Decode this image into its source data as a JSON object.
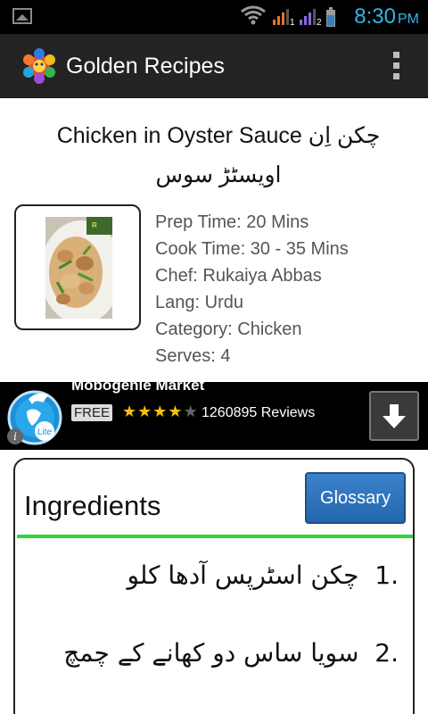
{
  "status_bar": {
    "time": "8:30",
    "ampm": "PM",
    "sim1": "1",
    "sim2": "2"
  },
  "action_bar": {
    "title": "Golden Recipes",
    "logo_icon": "golden-recipes-logo",
    "menu_icon": "overflow-menu-icon"
  },
  "recipe": {
    "title": "Chicken in Oyster Sauce چکن اِن اویسٹڑ سوس",
    "details": [
      {
        "label": "Prep Time:",
        "value": "20 Mins"
      },
      {
        "label": "Cook Time:",
        "value": "30 - 35 Mins"
      },
      {
        "label": "Chef:",
        "value": "Rukaiya Abbas"
      },
      {
        "label": "Lang:",
        "value": "Urdu"
      },
      {
        "label": "Category:",
        "value": "Chicken"
      },
      {
        "label": "Serves:",
        "value": "4"
      }
    ]
  },
  "ad": {
    "title": "Mobogenie Market",
    "price_badge": "FREE",
    "rating": 4,
    "rating_max": 5,
    "reviews": "1260895 Reviews",
    "badge": "Lite"
  },
  "ingredients": {
    "heading": "Ingredients",
    "glossary_label": "Glossary",
    "items": [
      {
        "num": "1.",
        "text": "چکن اسٹرپس آدھا کلو"
      },
      {
        "num": "2.",
        "text": "سویا ساس دو کھانے کے چمچ"
      }
    ]
  },
  "colors": {
    "clock": "#31b6e7",
    "action_bar": "#232323",
    "glossary_button": "#2f74bd",
    "divider": "#27d83a",
    "stars": "#f4c20d"
  }
}
